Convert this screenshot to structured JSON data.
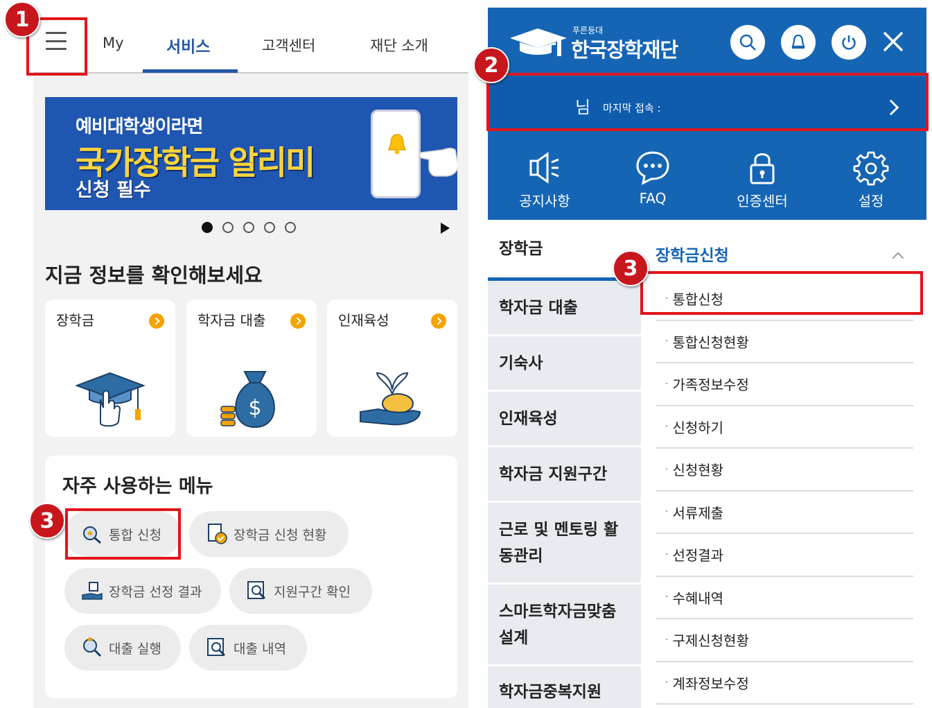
{
  "left": {
    "tabs": [
      "My",
      "서비스",
      "고객센터",
      "재단 소개"
    ],
    "banner": {
      "line1": "예비대학생이라면",
      "line2": "국가장학금 알리미",
      "line3": "신청 필수"
    },
    "section_title": "지금 정보를 확인해보세요",
    "cards": [
      {
        "label": "장학금",
        "icon": "graduation-cap-icon"
      },
      {
        "label": "학자금 대출",
        "icon": "money-bag-icon"
      },
      {
        "label": "인재육성",
        "icon": "sprout-hand-icon"
      }
    ],
    "favorites": {
      "title": "자주 사용하는 메뉴",
      "items": [
        {
          "label": "통합 신청",
          "icon": "search-doc-icon"
        },
        {
          "label": "장학금 신청 현황",
          "icon": "document-check-icon"
        },
        {
          "label": "장학금 선정 결과",
          "icon": "award-hand-icon"
        },
        {
          "label": "지원구간 확인",
          "icon": "magnify-doc-icon"
        },
        {
          "label": "대출 실행",
          "icon": "search-coin-icon"
        },
        {
          "label": "대출 내역",
          "icon": "magnify-doc-icon"
        }
      ]
    }
  },
  "right": {
    "brand_small": "푸른등대",
    "brand": "한국장학재단",
    "user": {
      "suffix": "님",
      "last_access": "마지막 접속 :"
    },
    "quick": [
      {
        "label": "공지사항",
        "icon": "megaphone-icon"
      },
      {
        "label": "FAQ",
        "icon": "chat-bubble-icon"
      },
      {
        "label": "인증센터",
        "icon": "lock-icon"
      },
      {
        "label": "설정",
        "icon": "gear-icon"
      }
    ],
    "left_menu": [
      "장학금",
      "학자금 대출",
      "기숙사",
      "인재육성",
      "학자금 지원구간",
      "근로 및 멘토링 활동관리",
      "스마트학자금맞춤설계",
      "학자금중복지원"
    ],
    "sub_menu_title": "장학금신청",
    "sub_menu": [
      "통합신청",
      "통합신청현황",
      "가족정보수정",
      "신청하기",
      "신청현황",
      "서류제출",
      "선정결과",
      "수혜내역",
      "구제신청현황",
      "계좌정보수정"
    ]
  },
  "annotations": {
    "step1": "1",
    "step2": "2",
    "step3": "3"
  },
  "colors": {
    "brand_blue": "#1565b4",
    "highlight_red": "#e3141b",
    "accent_orange": "#f5a300"
  }
}
